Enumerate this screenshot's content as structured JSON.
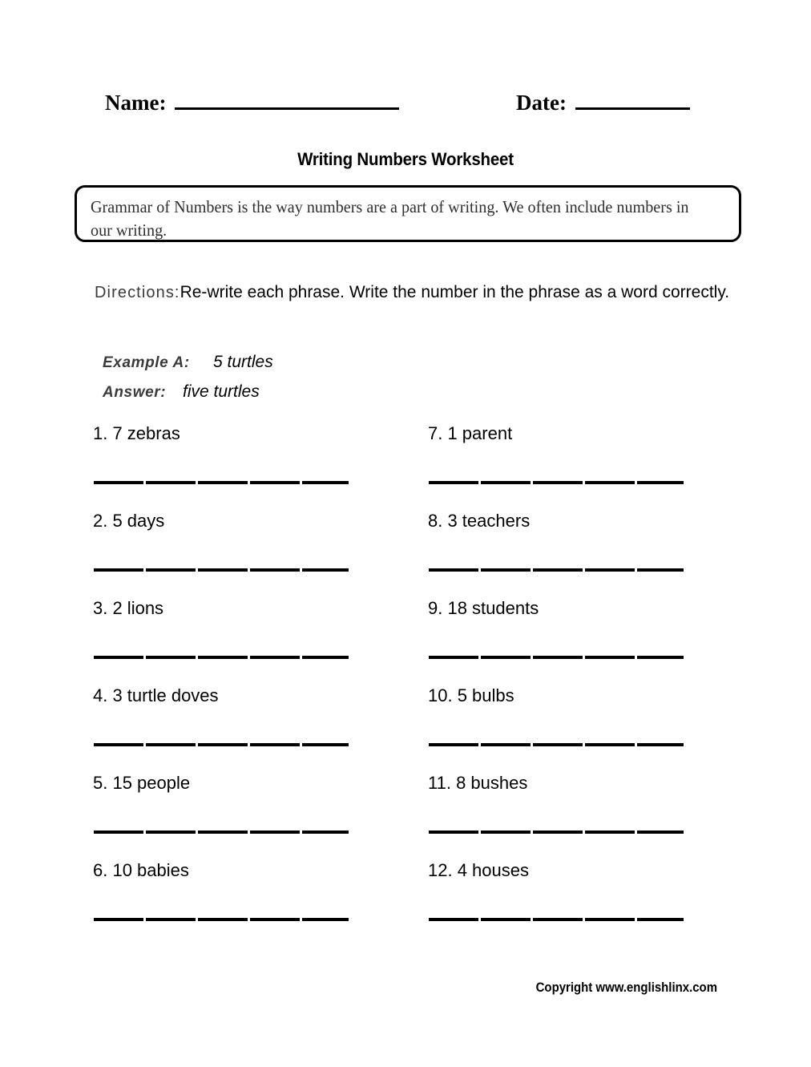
{
  "header": {
    "name_label": "Name:",
    "date_label": "Date:"
  },
  "title": "Writing Numbers Worksheet",
  "info_box": {
    "text": "Grammar of Numbers is the way numbers are a part of writing. We often include numbers in our writing."
  },
  "directions": {
    "label": "Directions:",
    "text": "Re-write each phrase. Write the number in the phrase as a word correctly."
  },
  "example": {
    "example_label": "Example A:",
    "example_value": "5 turtles",
    "answer_label": "Answer:",
    "answer_value": "five turtles"
  },
  "questions": {
    "left": [
      "1. 7 zebras",
      "2. 5 days",
      "3. 2 lions",
      "4. 3 turtle doves",
      "5. 15 people",
      "6. 10 babies"
    ],
    "right": [
      "7. 1 parent",
      "8. 3 teachers",
      "9. 18 students",
      "10. 5 bulbs",
      "11. 8 bushes",
      "12. 4 houses"
    ]
  },
  "footer": {
    "copyright": "Copyright www.englishlinx.com"
  }
}
